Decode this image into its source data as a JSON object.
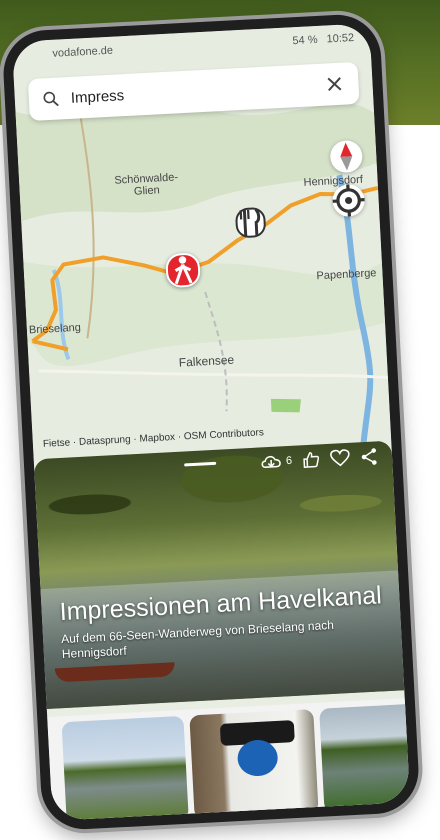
{
  "status_bar": {
    "carrier": "vodafone.de",
    "battery": "54 %",
    "time": "10:52"
  },
  "search": {
    "value": "Impress"
  },
  "map": {
    "places": [
      "Schönwalde-Glien",
      "Hennigsdorf",
      "Papenberge",
      "Brieselang",
      "Falkensee"
    ],
    "credits": "Fietse · Datasprung · Mapbox · OSM Contributors",
    "route_color": "#f0a02a",
    "marker_color": "#e3262d"
  },
  "card": {
    "count": "6",
    "title": "Impressionen am Havelkanal",
    "subtitle": "Auf dem 66-Seen-Wanderweg von Brieselang nach Hennigsdorf"
  },
  "icons": [
    "search-icon",
    "close-icon",
    "compass-icon",
    "locate-icon",
    "restaurant-icon",
    "hiker-icon",
    "cloud-download-icon",
    "thumbs-up-icon",
    "heart-icon",
    "share-icon"
  ]
}
